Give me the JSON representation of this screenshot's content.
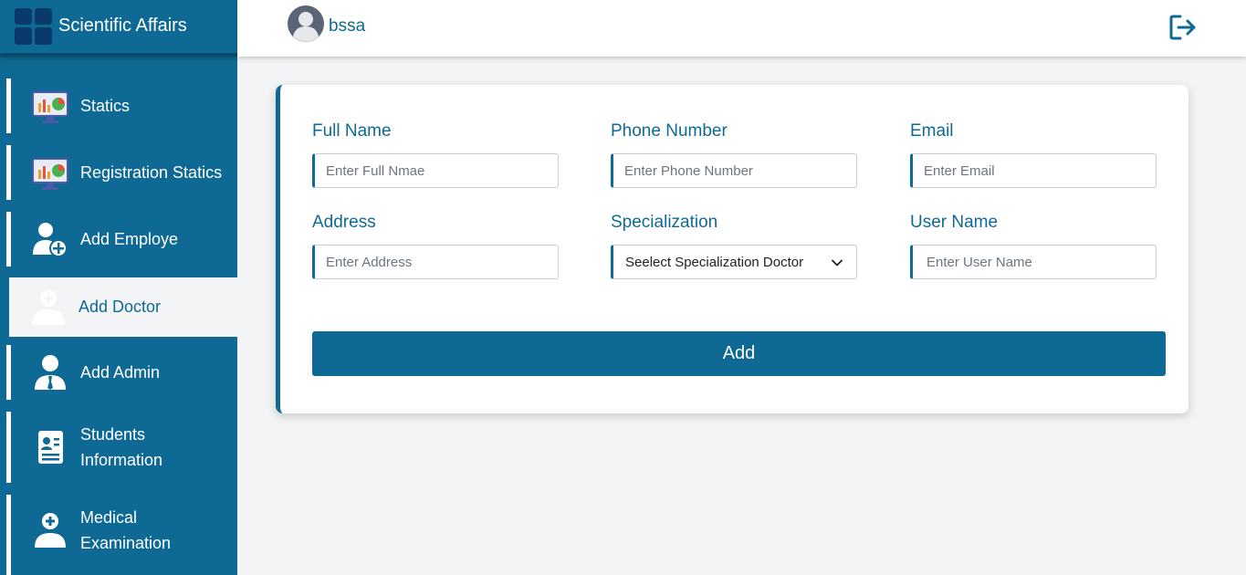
{
  "brand": {
    "title": "Scientific Affairs",
    "logo_icon": "grid-logo-icon"
  },
  "header": {
    "username": "bssa",
    "avatar_icon": "user-avatar-icon",
    "logout_icon": "logout-icon"
  },
  "sidebar": {
    "items": [
      {
        "label": "Statics",
        "icon": "statistics-monitor-icon",
        "active": false
      },
      {
        "label": "Registration Statics",
        "icon": "statistics-monitor-icon",
        "active": false
      },
      {
        "label": "Add Employe",
        "icon": "add-user-icon",
        "active": false
      },
      {
        "label": "Add Doctor",
        "icon": "doctor-icon",
        "active": true
      },
      {
        "label": "Add Admin",
        "icon": "admin-icon",
        "active": false
      },
      {
        "label": "Students Information",
        "line1": "Students",
        "line2": "Information",
        "icon": "id-card-icon",
        "active": false
      },
      {
        "label": "Medical Examination",
        "line1": "Medical",
        "line2": "Examination",
        "icon": "medical-user-icon",
        "active": false
      }
    ]
  },
  "form": {
    "full_name": {
      "label": "Full Name",
      "placeholder": "Enter Full Nmae",
      "value": ""
    },
    "phone": {
      "label": "Phone Number",
      "placeholder": "Enter Phone Number",
      "value": ""
    },
    "email": {
      "label": "Email",
      "placeholder": "Enter Email",
      "value": ""
    },
    "address": {
      "label": "Address",
      "placeholder": "Enter Address",
      "value": ""
    },
    "specialization": {
      "label": "Specialization",
      "selected": "Seelect Specialization Doctor"
    },
    "username": {
      "label": "User Name",
      "placeholder": "Enter User Name",
      "value": ""
    },
    "submit_label": "Add"
  },
  "colors": {
    "primary": "#0e6a94",
    "background": "#f3f4f6",
    "card": "#ffffff"
  }
}
